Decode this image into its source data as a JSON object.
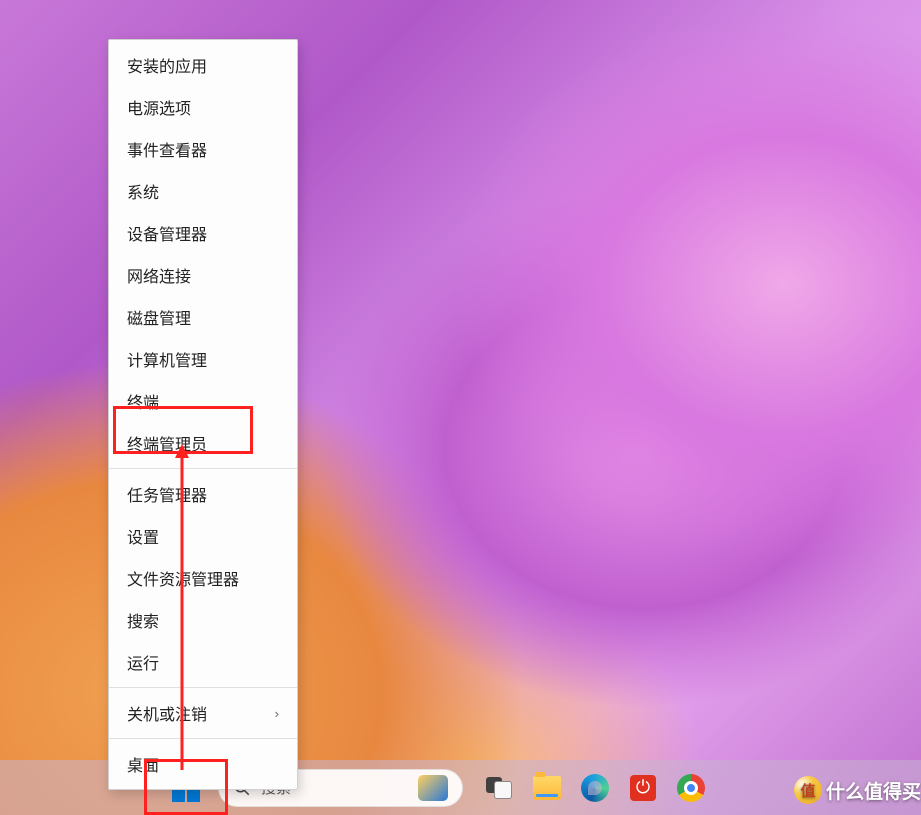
{
  "context_menu": {
    "items": [
      {
        "label": "安装的应用",
        "sep": false
      },
      {
        "label": "电源选项",
        "sep": false
      },
      {
        "label": "事件查看器",
        "sep": false
      },
      {
        "label": "系统",
        "sep": false
      },
      {
        "label": "设备管理器",
        "sep": false
      },
      {
        "label": "网络连接",
        "sep": false
      },
      {
        "label": "磁盘管理",
        "sep": false
      },
      {
        "label": "计算机管理",
        "sep": false
      },
      {
        "label": "终端",
        "sep": false
      },
      {
        "label": "终端管理员",
        "sep": true
      },
      {
        "label": "任务管理器",
        "sep": false
      },
      {
        "label": "设置",
        "sep": false
      },
      {
        "label": "文件资源管理器",
        "sep": false
      },
      {
        "label": "搜索",
        "sep": false
      },
      {
        "label": "运行",
        "sep": true
      },
      {
        "label": "关机或注销",
        "sep": true,
        "submenu": true
      },
      {
        "label": "桌面",
        "sep": false
      }
    ]
  },
  "taskbar": {
    "search_placeholder": "搜索"
  },
  "watermark": {
    "text": "什么值得买",
    "badge": "值"
  }
}
